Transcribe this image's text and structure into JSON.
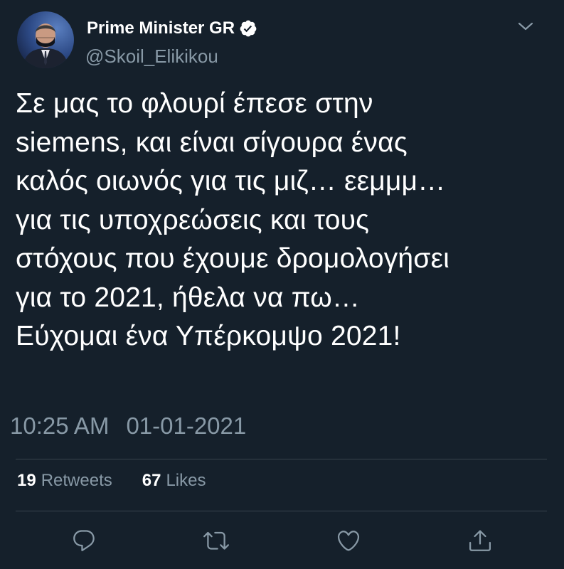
{
  "tweet": {
    "author": {
      "display_name": "Prime Minister GR",
      "handle": "@Skoil_Elikikou",
      "verified": true
    },
    "text_lines": [
      "Σε μας το φλουρί έπεσε στην",
      "siemens, και είναι σίγουρα ένας",
      "καλός οιωνός για τις μιζ… εεμμμ…",
      "για τις υποχρεώσεις και τους",
      "στόχους που έχουμε δρομολογήσει",
      "για το 2021, ήθελα να πω…",
      "Εύχομαι ένα Υπέρκομψο 2021!"
    ],
    "time": "10:25 AM",
    "date": "01-01-2021",
    "stats": {
      "retweets_count": "19",
      "retweets_label": "Retweets",
      "likes_count": "67",
      "likes_label": "Likes"
    }
  },
  "icons": {
    "menu": "chevron-down-icon",
    "verified": "verified-badge-icon",
    "reply": "reply-icon",
    "retweet": "retweet-icon",
    "like": "heart-icon",
    "share": "share-icon"
  },
  "colors": {
    "background": "#15202b",
    "text_primary": "#ffffff",
    "text_secondary": "#8899a6",
    "divider": "#38444d"
  }
}
